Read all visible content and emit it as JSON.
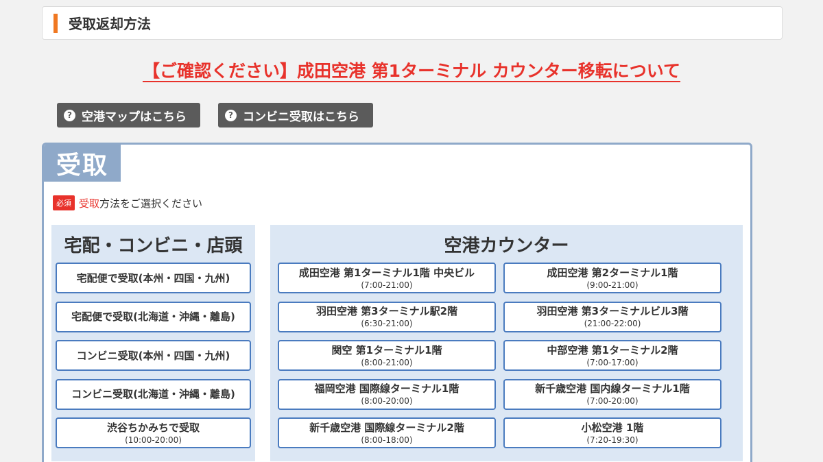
{
  "header": {
    "title": "受取返却方法"
  },
  "notice": {
    "link_text": "【ご確認ください】成田空港 第1ターミナル カウンター移転について"
  },
  "help_buttons": {
    "map": "空港マップはこちら",
    "convenience": "コンビニ受取はこちら"
  },
  "receive": {
    "tag": "受取",
    "required_badge": "必須",
    "instruction_highlight": "受取",
    "instruction_rest": "方法をご選択ください",
    "left_title": "宅配・コンビニ・店頭",
    "left_options": [
      {
        "name": "宅配便で受取(本州・四国・九州)",
        "hours": ""
      },
      {
        "name": "宅配便で受取(北海道・沖縄・離島)",
        "hours": ""
      },
      {
        "name": "コンビニ受取(本州・四国・九州)",
        "hours": ""
      },
      {
        "name": "コンビニ受取(北海道・沖縄・離島)",
        "hours": ""
      },
      {
        "name": "渋谷ちかみちで受取",
        "hours": "(10:00-20:00)"
      }
    ],
    "right_title": "空港カウンター",
    "airport_options": [
      {
        "name": "成田空港 第1ターミナル1階 中央ビル",
        "hours": "(7:00-21:00)"
      },
      {
        "name": "成田空港 第2ターミナル1階",
        "hours": "(9:00-21:00)"
      },
      {
        "name": "羽田空港 第3ターミナル駅2階",
        "hours": "(6:30-21:00)"
      },
      {
        "name": "羽田空港 第3ターミナルビル3階",
        "hours": "(21:00-22:00)"
      },
      {
        "name": "関空 第1ターミナル1階",
        "hours": "(8:00-21:00)"
      },
      {
        "name": "中部空港 第1ターミナル2階",
        "hours": "(7:00-17:00)"
      },
      {
        "name": "福岡空港 国際線ターミナル1階",
        "hours": "(8:00-20:00)"
      },
      {
        "name": "新千歳空港 国内線ターミナル1階",
        "hours": "(7:00-20:00)"
      },
      {
        "name": "新千歳空港 国際線ターミナル2階",
        "hours": "(8:00-18:00)"
      },
      {
        "name": "小松空港 1階",
        "hours": "(7:20-19:30)"
      }
    ]
  },
  "colors": {
    "accent_orange": "#f07822",
    "link_red": "#e8322b",
    "panel_blue": "#8fa9c9",
    "option_border": "#4a7bbf"
  }
}
